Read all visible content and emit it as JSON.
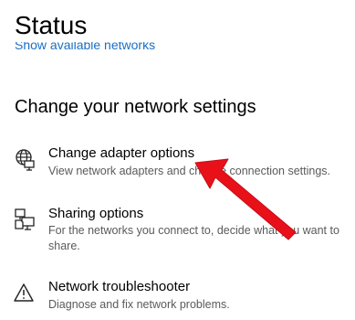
{
  "page": {
    "title": "Status",
    "show_networks_link": "Show available networks"
  },
  "section": {
    "heading": "Change your network settings"
  },
  "items": [
    {
      "title": "Change adapter options",
      "description": "View network adapters and change connection settings.",
      "icon": "globe-network-icon"
    },
    {
      "title": "Sharing options",
      "description": "For the networks you connect to, decide what you want to share.",
      "icon": "sharing-icon"
    },
    {
      "title": "Network troubleshooter",
      "description": "Diagnose and fix network problems.",
      "icon": "warning-icon"
    }
  ],
  "colors": {
    "link": "#1a6fc4",
    "description": "#5a5a5a",
    "annotation_arrow": "#e8111a"
  }
}
